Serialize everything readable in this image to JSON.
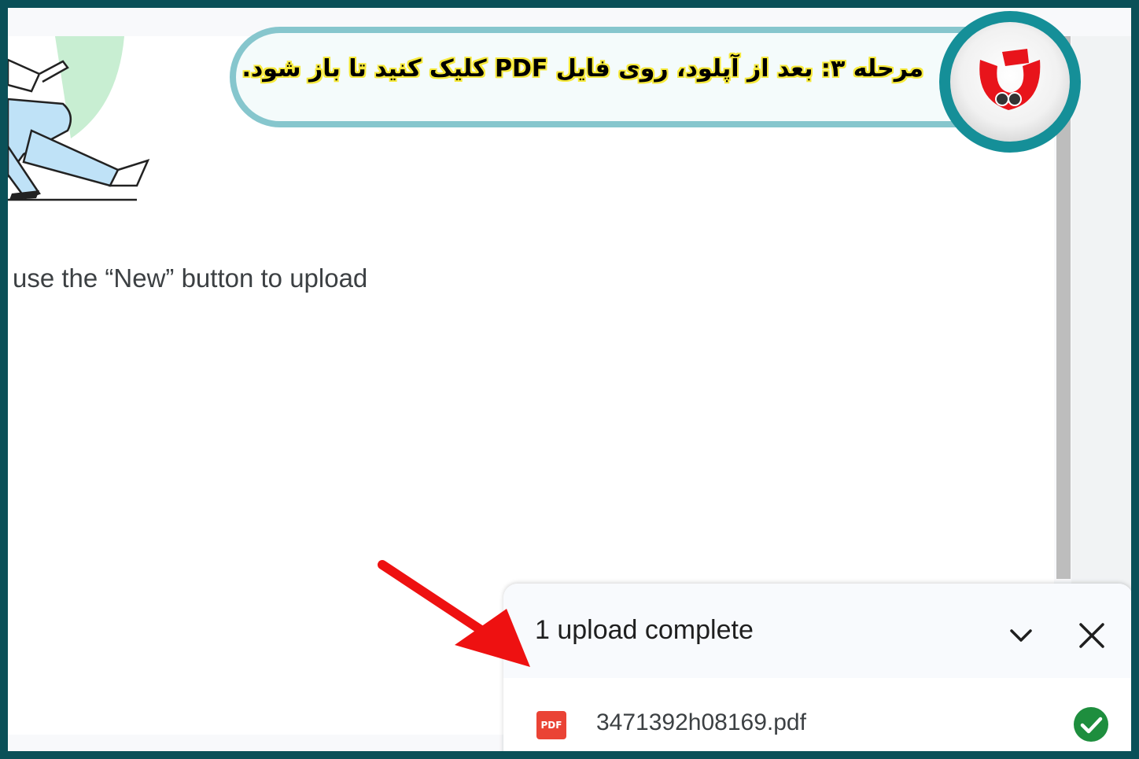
{
  "banner": {
    "step_text": "مرحله ۳: بعد از آپلود، روی فایل PDF کلیک کنید تا باز شود."
  },
  "drive": {
    "empty_hint": "use the “New” button to upload"
  },
  "upload_panel": {
    "title": "1 upload complete",
    "file": {
      "name": "3471392h08169.pdf",
      "type_label": "PDF",
      "status_icon": "check-circle-icon"
    }
  },
  "colors": {
    "frame": "#0a5058",
    "banner_border": "#86c6cd",
    "highlight": "#f6e93a",
    "logo_ring": "#158f98",
    "logo_red": "#e8141b",
    "arrow": "#ee1111",
    "pdf_red": "#ea4335",
    "success_green": "#1e8e3e"
  }
}
